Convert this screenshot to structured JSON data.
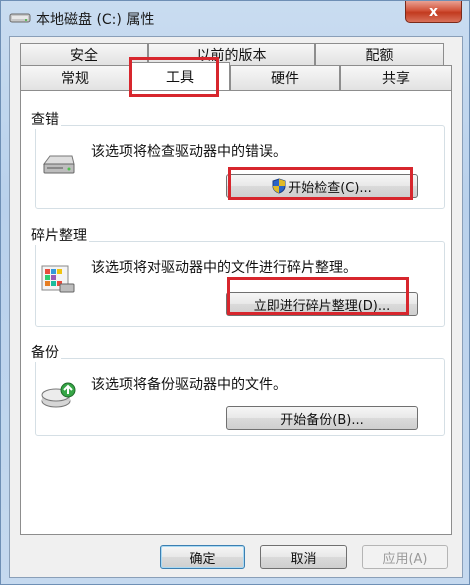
{
  "window": {
    "title": "本地磁盘 (C:) 属性",
    "close_label": "x"
  },
  "tabs_row1": [
    {
      "label": "安全"
    },
    {
      "label": "以前的版本"
    },
    {
      "label": "配额"
    }
  ],
  "tabs_row2": [
    {
      "label": "常规"
    },
    {
      "label": "工具"
    },
    {
      "label": "硬件"
    },
    {
      "label": "共享"
    }
  ],
  "active_tab": "工具",
  "groups": {
    "error_check": {
      "label": "查错",
      "description": "该选项将检查驱动器中的错误。",
      "button": "开始检查(C)..."
    },
    "defrag": {
      "label": "碎片整理",
      "description": "该选项将对驱动器中的文件进行碎片整理。",
      "button": "立即进行碎片整理(D)..."
    },
    "backup": {
      "label": "备份",
      "description": "该选项将备份驱动器中的文件。",
      "button": "开始备份(B)..."
    }
  },
  "footer": {
    "ok": "确定",
    "cancel": "取消",
    "apply": "应用(A)"
  },
  "icons": {
    "title": "drive-icon",
    "error_check": "hard-drive-icon",
    "defrag": "defrag-icon",
    "backup": "backup-icon",
    "uac": "uac-shield-icon"
  },
  "colors": {
    "highlight": "#d7262d",
    "close_button": "#c23a1f"
  }
}
